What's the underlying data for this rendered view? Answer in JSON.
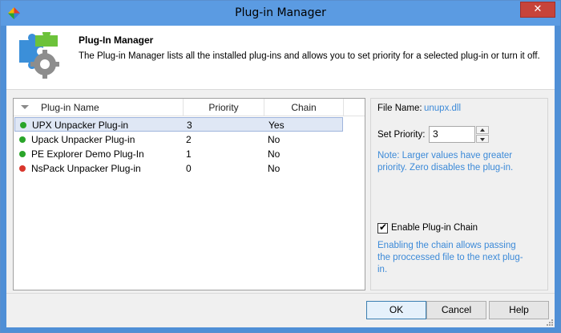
{
  "window": {
    "title": "Plug-in Manager",
    "close_glyph": "✕"
  },
  "header": {
    "title": "Plug-In Manager",
    "description": "The Plug-in Manager lists all the installed plug-ins and allows you to set priority for a selected plug-in or turn it off."
  },
  "list": {
    "columns": [
      "Plug-in Name",
      "Priority",
      "Chain"
    ],
    "rows": [
      {
        "name": "UPX Unpacker Plug-in",
        "priority": "3",
        "chain": "Yes",
        "status_color": "#2aa52a",
        "selected": true
      },
      {
        "name": "Upack Unpacker Plug-in",
        "priority": "2",
        "chain": "No",
        "status_color": "#2aa52a",
        "selected": false
      },
      {
        "name": "PE Explorer Demo Plug-In",
        "priority": "1",
        "chain": "No",
        "status_color": "#2aa52a",
        "selected": false
      },
      {
        "name": "NsPack Unpacker Plug-in",
        "priority": "0",
        "chain": "No",
        "status_color": "#d9362c",
        "selected": false
      }
    ]
  },
  "details": {
    "file_label": "File Name:",
    "file_value": "unupx.dll",
    "priority_label": "Set Priority:",
    "priority_value": "3",
    "priority_note": "Note: Larger values have greater priority. Zero disables the plug-in.",
    "chain_checkbox_label": "Enable Plug-in Chain",
    "chain_checked": true,
    "chain_note": "Enabling the chain allows passing the proccessed file to the next plug-in."
  },
  "buttons": {
    "ok": "OK",
    "cancel": "Cancel",
    "help": "Help"
  },
  "colors": {
    "titlebar": "#5b9be2",
    "accent_text": "#3c8ad8",
    "selection": "#dfe7f5"
  }
}
